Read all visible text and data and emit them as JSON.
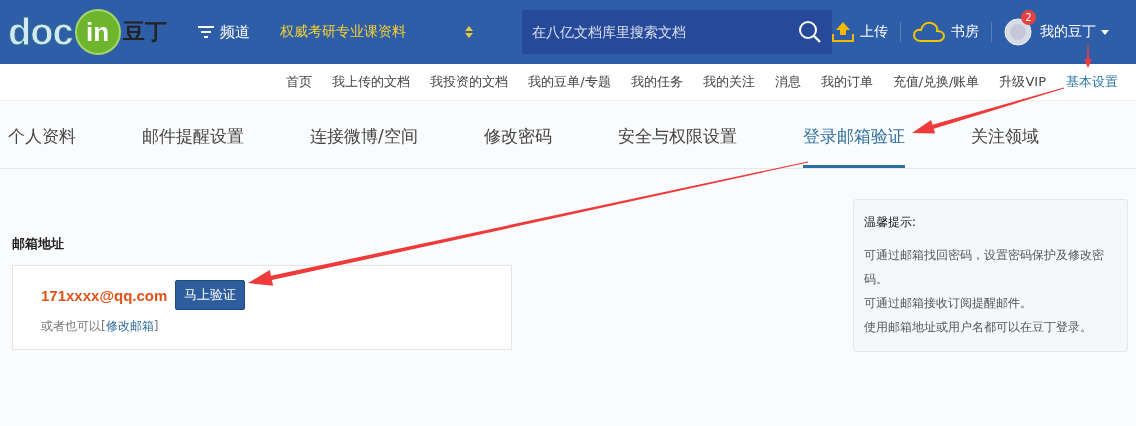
{
  "header": {
    "logo": {
      "part_1": "doc",
      "part_2": "in",
      "part_3": "豆丁"
    },
    "channel_menu": "频道",
    "promo_link": "权威考研专业课资料",
    "search": {
      "placeholder": "在八亿文档库里搜索文档"
    },
    "upload": "上传",
    "bookshelf": "书房",
    "notification_badge": "2",
    "user_menu": "我的豆丁"
  },
  "subnav": [
    {
      "label": "首页",
      "selected": false
    },
    {
      "label": "我上传的文档",
      "selected": false
    },
    {
      "label": "我投资的文档",
      "selected": false
    },
    {
      "label": "我的豆单/专题",
      "selected": false
    },
    {
      "label": "我的任务",
      "selected": false
    },
    {
      "label": "我的关注",
      "selected": false
    },
    {
      "label": "消息",
      "selected": false
    },
    {
      "label": "我的订单",
      "selected": false
    },
    {
      "label": "充值/兑换/账单",
      "selected": false
    },
    {
      "label": "升级VIP",
      "selected": false
    },
    {
      "label": "基本设置",
      "selected": true
    }
  ],
  "tabs": [
    {
      "label": "个人资料",
      "selected": false
    },
    {
      "label": "邮件提醒设置",
      "selected": false
    },
    {
      "label": "连接微博/空间",
      "selected": false
    },
    {
      "label": "修改密码",
      "selected": false
    },
    {
      "label": "安全与权限设置",
      "selected": false
    },
    {
      "label": "登录邮箱验证",
      "selected": true
    },
    {
      "label": "关注领域",
      "selected": false
    }
  ],
  "email_section": {
    "heading": "邮箱地址",
    "email": "171xxxx@qq.com",
    "verify_button": "马上验证",
    "alt_prefix": "或者也可以[",
    "alt_link": "修改邮箱",
    "alt_suffix": "]"
  },
  "tip": {
    "title": "温馨提示:",
    "lines": [
      "可通过邮箱找回密码，设置密码保护及修改密码。",
      "可通过邮箱接收订阅提醒邮件。",
      "使用邮箱地址或用户名都可以在豆丁登录。"
    ]
  }
}
